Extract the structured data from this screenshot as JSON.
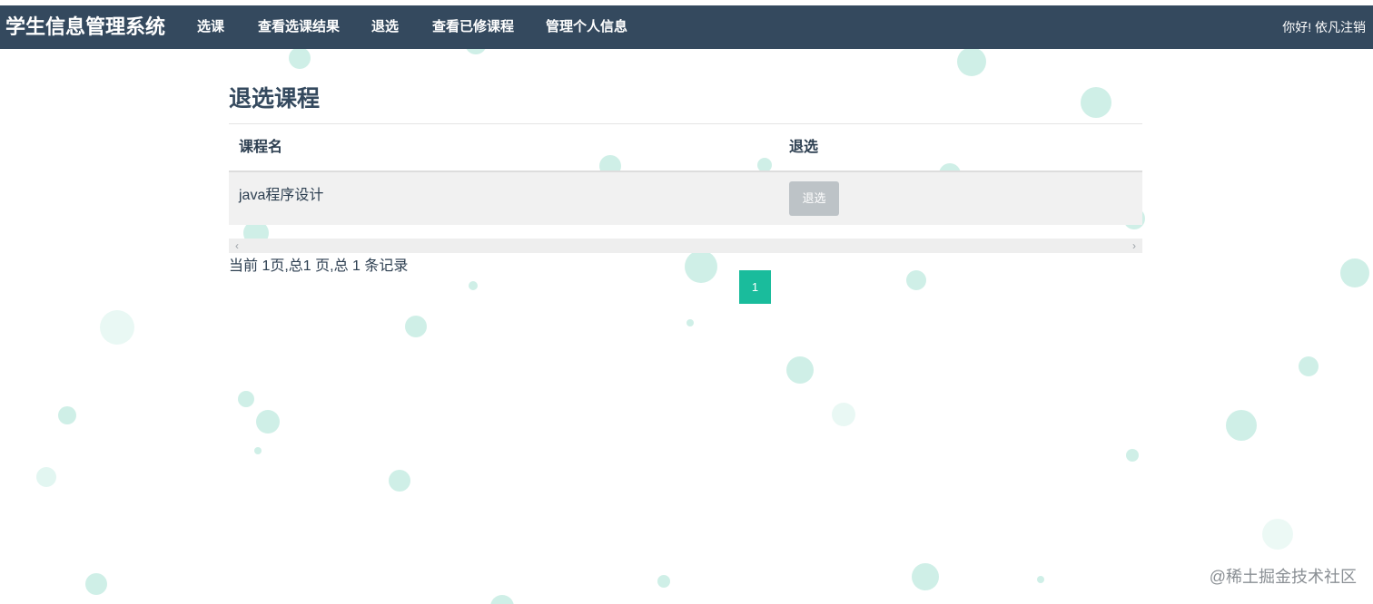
{
  "navbar": {
    "brand": "学生信息管理系统",
    "items": [
      {
        "label": "选课"
      },
      {
        "label": "查看选课结果"
      },
      {
        "label": "退选"
      },
      {
        "label": "查看已修课程"
      },
      {
        "label": "管理个人信息"
      }
    ],
    "greeting": "你好!",
    "username": "依凡",
    "logout": "注销"
  },
  "page": {
    "title": "退选课程"
  },
  "table": {
    "columns": [
      "课程名",
      "退选"
    ],
    "rows": [
      {
        "course": "java程序设计",
        "action": "退选"
      }
    ]
  },
  "scrollbar": {
    "left_arrow": "‹",
    "right_arrow": "›"
  },
  "pagination": {
    "summary": "当前 1页,总1 页,总 1 条记录",
    "current_page": "1"
  },
  "watermark": "@稀土掘金技术社区",
  "colors": {
    "navbar": "#34495e",
    "accent": "#1abc9c",
    "button_disabled": "#bdc3c7",
    "bubble": "#bfeadf"
  }
}
